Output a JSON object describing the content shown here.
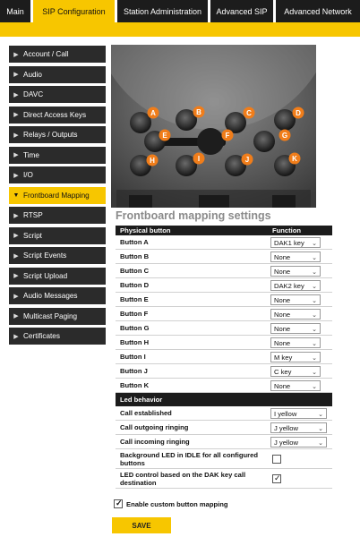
{
  "tabs": [
    {
      "label": "Main"
    },
    {
      "label": "SIP Configuration"
    },
    {
      "label": "Station Administration"
    },
    {
      "label": "Advanced SIP"
    },
    {
      "label": "Advanced Network"
    }
  ],
  "sidebar": {
    "items": [
      {
        "label": "Account / Call"
      },
      {
        "label": "Audio"
      },
      {
        "label": "DAVC"
      },
      {
        "label": "Direct Access Keys"
      },
      {
        "label": "Relays / Outputs"
      },
      {
        "label": "Time"
      },
      {
        "label": "I/O"
      },
      {
        "label": "Frontboard Mapping"
      },
      {
        "label": "RTSP"
      },
      {
        "label": "Script"
      },
      {
        "label": "Script Events"
      },
      {
        "label": "Script Upload"
      },
      {
        "label": "Audio Messages"
      },
      {
        "label": "Multicast Paging"
      },
      {
        "label": "Certificates"
      }
    ]
  },
  "photo": {
    "buttons": [
      "A",
      "B",
      "C",
      "D",
      "E",
      "F",
      "G",
      "H",
      "I",
      "J",
      "K"
    ]
  },
  "section_title": "Frontboard mapping settings",
  "table": {
    "col_button": "Physical button",
    "col_function": "Function",
    "rows": [
      {
        "label": "Button A",
        "value": "DAK1 key"
      },
      {
        "label": "Button B",
        "value": "None"
      },
      {
        "label": "Button C",
        "value": "None"
      },
      {
        "label": "Button D",
        "value": "DAK2 key"
      },
      {
        "label": "Button E",
        "value": "None"
      },
      {
        "label": "Button F",
        "value": "None"
      },
      {
        "label": "Button G",
        "value": "None"
      },
      {
        "label": "Button H",
        "value": "None"
      },
      {
        "label": "Button I",
        "value": "M key"
      },
      {
        "label": "Button J",
        "value": "C key"
      },
      {
        "label": "Button K",
        "value": "None"
      }
    ],
    "led_header": "Led behavior",
    "led_rows": [
      {
        "label": "Call established",
        "value": "I yellow"
      },
      {
        "label": "Call outgoing ringing",
        "value": "J yellow"
      },
      {
        "label": "Call incoming ringing",
        "value": "J yellow"
      }
    ],
    "check_rows": [
      {
        "label": "Background LED in IDLE for all configured buttons",
        "checked": false
      },
      {
        "label": "LED control based on the DAK key call destination",
        "checked": true
      }
    ]
  },
  "enable_custom_label": "Enable custom button mapping",
  "save_label": "SAVE",
  "colors": {
    "accent": "#f7c600",
    "dark": "#1c1c1c",
    "button_orange": "#f07d1a"
  }
}
